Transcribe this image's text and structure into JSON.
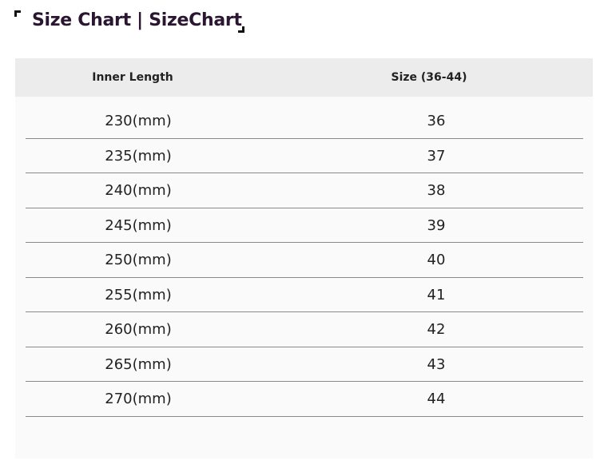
{
  "title": "Size Chart | SizeChart",
  "table": {
    "headers": [
      "Inner Length",
      "Size (36-44)"
    ],
    "rows": [
      [
        "230(mm)",
        "36"
      ],
      [
        "235(mm)",
        "37"
      ],
      [
        "240(mm)",
        "38"
      ],
      [
        "245(mm)",
        "39"
      ],
      [
        "250(mm)",
        "40"
      ],
      [
        "255(mm)",
        "41"
      ],
      [
        "260(mm)",
        "42"
      ],
      [
        "265(mm)",
        "43"
      ],
      [
        "270(mm)",
        "44"
      ]
    ]
  }
}
